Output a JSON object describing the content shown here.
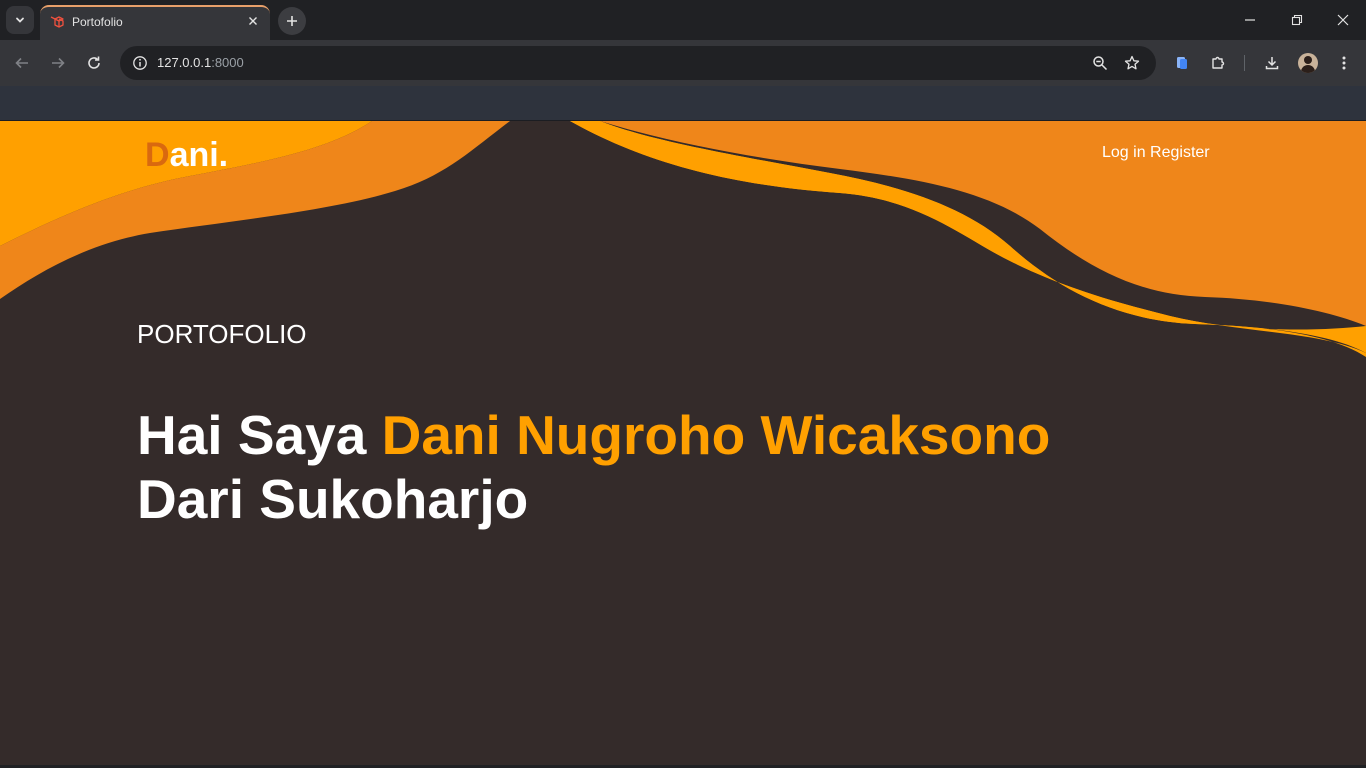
{
  "browser": {
    "tab_title": "Portofolio",
    "url_host": "127.0.0.1",
    "url_port": ":8000",
    "icons": {
      "tab_search": "chevron-down-icon",
      "favicon": "laravel-icon",
      "tab_close": "close-icon",
      "new_tab": "plus-icon",
      "back": "back-arrow-icon",
      "forward": "forward-arrow-icon",
      "reload": "reload-icon",
      "site_info": "info-icon",
      "zoom": "zoom-out-icon",
      "bookmark": "star-icon",
      "tab_app": "app-icon",
      "extensions": "puzzle-icon",
      "downloads": "download-icon",
      "profile": "avatar",
      "menu": "kebab-menu-icon",
      "minimize": "minimize-icon",
      "restore": "restore-icon",
      "close_window": "close-icon"
    }
  },
  "page": {
    "logo_first": "D",
    "logo_rest": "ani.",
    "login": "Log in",
    "register": "Register",
    "eyebrow": "PORTOFOLIO",
    "greeting": "Hai Saya ",
    "name": "Dani Nugroho Wicaksono",
    "origin": "Dari Sukoharjo"
  },
  "colors": {
    "background": "#342b2a",
    "orange_light": "#ffa000",
    "orange_dark": "#ef861a",
    "logo_accent": "#d9690f"
  }
}
